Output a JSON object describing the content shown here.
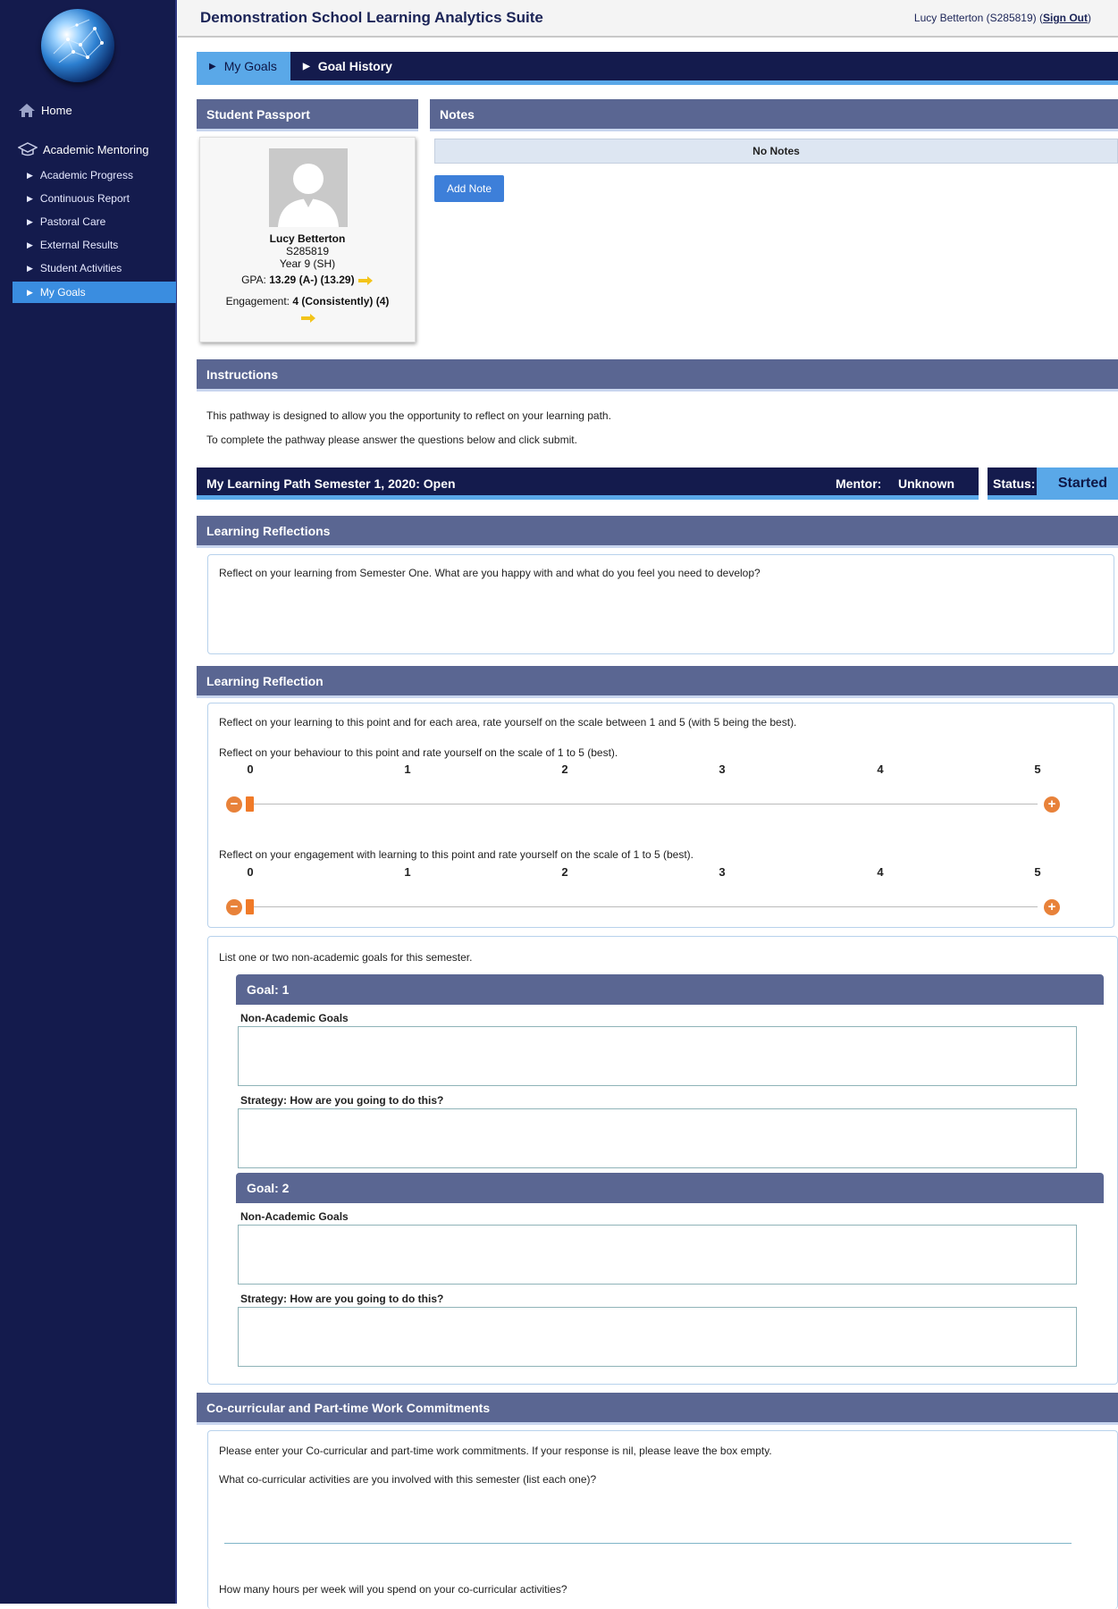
{
  "app": {
    "title": "Demonstration School Learning Analytics Suite"
  },
  "user": {
    "text": "Lucy Betterton (S285819)",
    "paren_open": "(",
    "sign_out": "Sign Out",
    "paren_close": ")"
  },
  "sidebar": {
    "home": "Home",
    "section": "Academic Mentoring",
    "items": [
      "Academic Progress",
      "Continuous Report",
      "Pastoral Care",
      "External Results",
      "Student Activities",
      "My Goals"
    ],
    "active": "My Goals"
  },
  "tabs": {
    "my_goals": "My Goals",
    "goal_history": "Goal History"
  },
  "passport": {
    "header": "Student Passport",
    "name": "Lucy Betterton",
    "id": "S285819",
    "year": "Year 9 (SH)",
    "gpa_label": "GPA:",
    "gpa_value": "13.29 (A-) (13.29)",
    "engagement_label": "Engagement:",
    "engagement_value": "4 (Consistently) (4)"
  },
  "notes": {
    "header": "Notes",
    "empty": "No Notes",
    "add_button": "Add Note"
  },
  "instructions": {
    "header": "Instructions",
    "line1": "This pathway is designed to allow you the opportunity to reflect on your learning path.",
    "line2": "To complete the pathway please answer the questions below and click submit."
  },
  "path": {
    "title": "My Learning Path Semester 1, 2020:  Open",
    "mentor_label": "Mentor:",
    "mentor_value": "Unknown",
    "status_label": "Status:",
    "status_value": "Started"
  },
  "reflections": {
    "header": "Learning Reflections",
    "prompt": "Reflect on your learning from Semester One. What are you happy with and what do you feel you need to develop?"
  },
  "reflection": {
    "header": "Learning Reflection",
    "intro": "Reflect on your learning to this point and for each area, rate yourself on the scale between 1 and 5 (with 5 being the best).",
    "behaviour_prompt": "Reflect on your behaviour to this point and rate yourself on the scale of 1 to 5 (best).",
    "engagement_prompt": "Reflect on your engagement with learning to this point and rate yourself on the scale of 1 to 5 (best).",
    "ticks": [
      "0",
      "1",
      "2",
      "3",
      "4",
      "5"
    ],
    "behaviour_value": 0,
    "engagement_value": 0
  },
  "goals": {
    "intro": "List one or two non-academic goals for this semester.",
    "goal1_header": "Goal: 1",
    "goal2_header": "Goal: 2",
    "goal_label": "Non-Academic Goals",
    "strategy_label": "Strategy: How are you going to do this?"
  },
  "cocurricular": {
    "header": "Co-curricular and Part-time Work Commitments",
    "intro": "Please enter your Co-curricular and part-time work commitments. If your response is nil, please leave the box empty.",
    "q1": "What co-curricular activities are you involved with this semester (list each one)?",
    "q2": "How many hours per week will you spend on your co-curricular activities?"
  },
  "colors": {
    "navy": "#141b4d",
    "accent": "#5aa8e8",
    "header": "#5a6692",
    "orange": "#f07a28"
  }
}
